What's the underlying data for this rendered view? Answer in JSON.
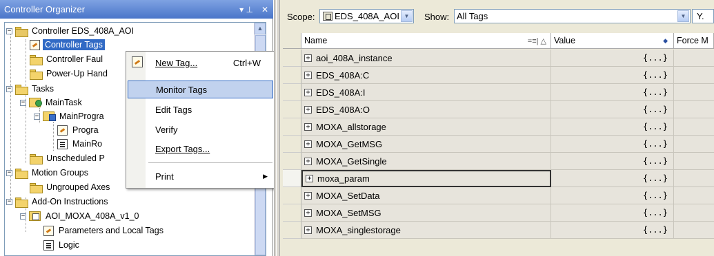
{
  "organizer": {
    "title": "Controller Organizer",
    "pin_glyph": "▾ ᛘ",
    "close_glyph": "✕",
    "tree": {
      "controller": "Controller EDS_408A_AOI",
      "controller_tags": "Controller Tags",
      "controller_fault": "Controller Faul",
      "power_up": "Power-Up Hand",
      "tasks": "Tasks",
      "main_task": "MainTask",
      "main_program": "MainProgra",
      "program_tags": "Progra",
      "main_routine": "MainRo",
      "unscheduled": "Unscheduled P",
      "motion_groups": "Motion Groups",
      "ungrouped_axes": "Ungrouped Axes",
      "aoi": "Add-On Instructions",
      "aoi_item": "AOI_MOXA_408A_v1_0",
      "params": "Parameters and Local Tags",
      "logic": "Logic"
    }
  },
  "context_menu": {
    "new_tag": "New Tag...",
    "new_tag_shortcut": "Ctrl+W",
    "monitor_tags": "Monitor Tags",
    "edit_tags": "Edit Tags",
    "verify": "Verify",
    "export_tags": "Export Tags...",
    "print": "Print"
  },
  "tag_editor": {
    "scope_label": "Scope:",
    "scope_value": "EDS_408A_AOI",
    "show_label": "Show:",
    "show_value": "All Tags",
    "filter_glyph": "Y.",
    "columns": {
      "name": "Name",
      "name_sort": "=≡| △",
      "value": "Value",
      "value_marker": "◆",
      "force": "Force M"
    },
    "rows": [
      {
        "name": "aoi_408A_instance",
        "value": "{...}"
      },
      {
        "name": "EDS_408A:C",
        "value": "{...}"
      },
      {
        "name": "EDS_408A:I",
        "value": "{...}"
      },
      {
        "name": "EDS_408A:O",
        "value": "{...}"
      },
      {
        "name": "MOXA_allstorage",
        "value": "{...}"
      },
      {
        "name": "MOXA_GetMSG",
        "value": "{...}"
      },
      {
        "name": "MOXA_GetSingle",
        "value": "{...}"
      },
      {
        "name": "moxa_param",
        "value": "{...}"
      },
      {
        "name": "MOXA_SetData",
        "value": "{...}"
      },
      {
        "name": "MOXA_SetMSG",
        "value": "{...}"
      },
      {
        "name": "MOXA_singlestorage",
        "value": "{...}"
      }
    ]
  },
  "colors": {
    "titlebar": "#4a75c9",
    "selection": "#316ac5",
    "menu_highlight": "#c1d2ee",
    "grid_cell": "#e7e4dc"
  }
}
